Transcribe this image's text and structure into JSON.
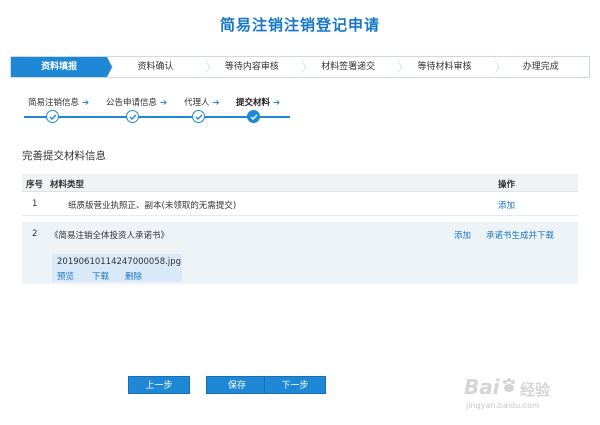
{
  "page": {
    "title": "简易注销注销登记申请"
  },
  "steps": [
    {
      "label": "资料填报",
      "active": true
    },
    {
      "label": "资料确认",
      "active": false
    },
    {
      "label": "等待内容审核",
      "active": false
    },
    {
      "label": "材料签署递交",
      "active": false
    },
    {
      "label": "等待材料审核",
      "active": false
    },
    {
      "label": "办理完成",
      "active": false
    }
  ],
  "substeps": [
    {
      "label": "简易注销信息"
    },
    {
      "label": "公告申请信息"
    },
    {
      "label": "代理人"
    },
    {
      "label": "提交材料"
    }
  ],
  "section": {
    "title": "完善提交材料信息"
  },
  "table": {
    "headers": {
      "no": "序号",
      "type": "材料类型",
      "op": "操作"
    },
    "rows": [
      {
        "no": "1",
        "type": "纸质版营业执照正、副本(未领取的无需提交)",
        "action": "添加"
      },
      {
        "no": "2",
        "type": "《简易注销全体投资人承诺书》",
        "action": "添加",
        "action2": "承诺书生成并下载",
        "file": {
          "name": "20190610114247000058.jpg",
          "preview": "预览",
          "download": "下载",
          "delete": "删除"
        }
      }
    ]
  },
  "buttons": {
    "prev": "上一步",
    "save": "保存",
    "next": "下一步"
  },
  "watermark": {
    "logo": "Bai",
    "suffix": "经验",
    "url": "jingyan.baidu.com"
  },
  "colors": {
    "accent": "#1e88d6",
    "title": "#1677c8"
  }
}
